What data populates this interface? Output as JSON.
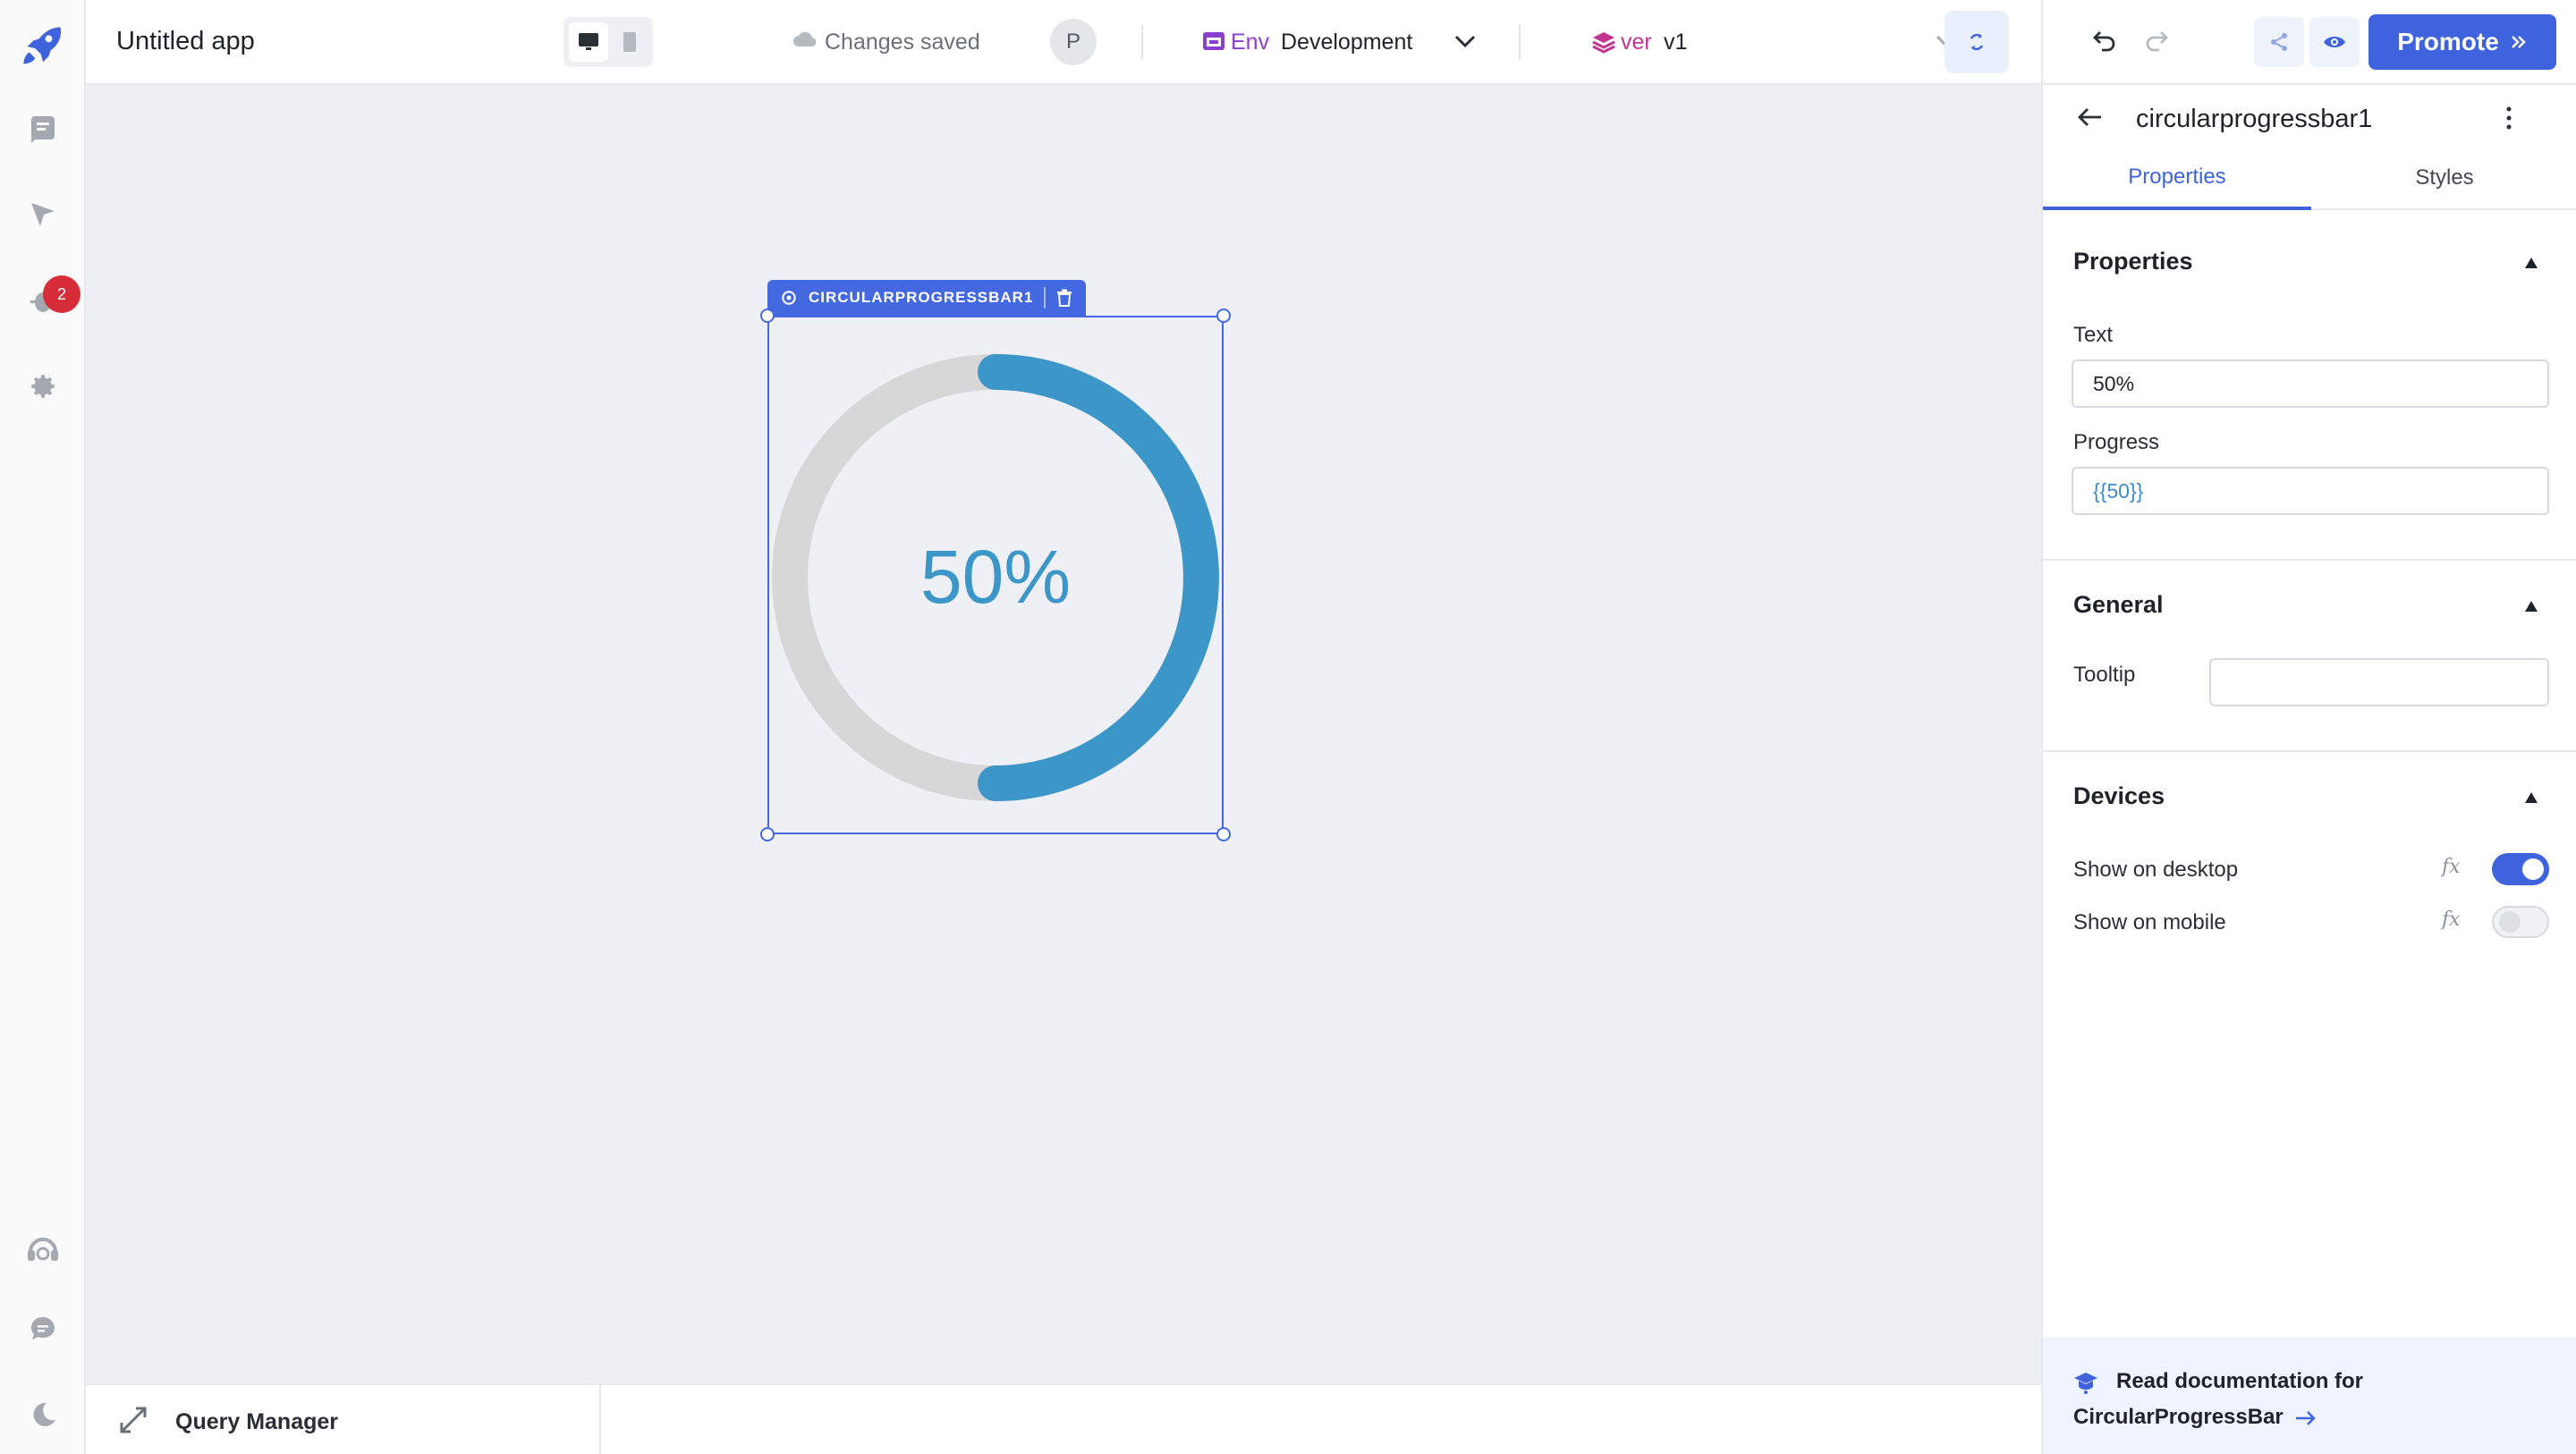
{
  "app": {
    "title": "Untitled app"
  },
  "topbar": {
    "save_status": "Changes saved",
    "avatar_initial": "P",
    "env_label": "Env",
    "env_value": "Development",
    "version_label": "ver",
    "version_value": "v1",
    "promote_label": "Promote"
  },
  "sidebar": {
    "notification_count": "2"
  },
  "canvas": {
    "widget_tag": "CIRCULARPROGRESSBAR1",
    "progress_text": "50%",
    "progress_value": 50,
    "colors": {
      "track": "#d7d7d7",
      "fill": "#3c97c8",
      "text": "#3c97c8"
    }
  },
  "query_manager": {
    "label": "Query Manager"
  },
  "panel": {
    "component_name": "circularprogressbar1",
    "tabs": [
      {
        "label": "Properties"
      },
      {
        "label": "Styles"
      }
    ],
    "sections": {
      "properties": {
        "title": "Properties",
        "text_label": "Text",
        "text_value": "50%",
        "progress_label": "Progress",
        "progress_value": "{{50}}"
      },
      "general": {
        "title": "General",
        "tooltip_label": "Tooltip",
        "tooltip_value": ""
      },
      "devices": {
        "title": "Devices",
        "desktop_label": "Show on desktop",
        "mobile_label": "Show on mobile",
        "fx": "fx"
      }
    },
    "docs": {
      "line1": "Read documentation for",
      "line2": "CircularProgressBar"
    }
  },
  "colors": {
    "accent": "#3e63dd",
    "badge": "#d72d39",
    "env": "#8a3fd1",
    "version": "#c2358f"
  }
}
